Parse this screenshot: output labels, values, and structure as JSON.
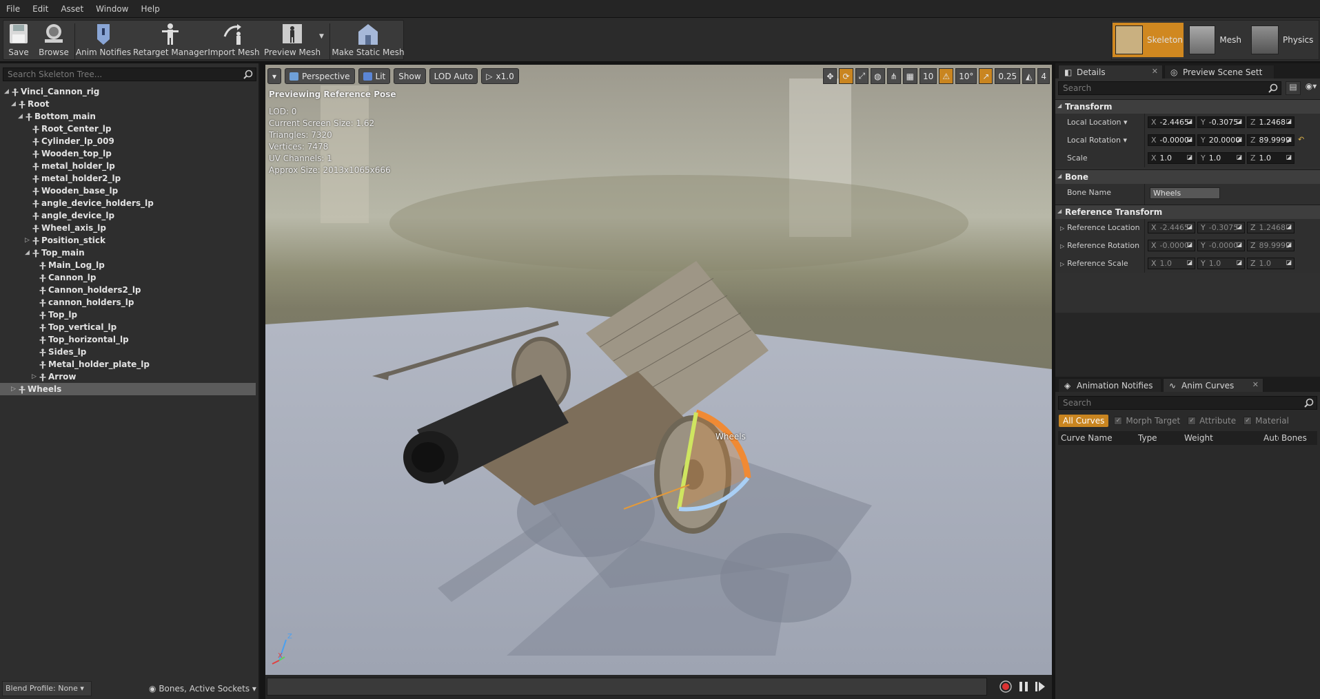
{
  "menu": [
    "File",
    "Edit",
    "Asset",
    "Window",
    "Help"
  ],
  "toolbar": {
    "save": "Save",
    "browse": "Browse",
    "anim_notifies": "Anim Notifies",
    "retarget_manager": "Retarget Manager",
    "import_mesh": "Import Mesh",
    "preview_mesh": "Preview Mesh",
    "make_static_mesh": "Make Static Mesh"
  },
  "modes": {
    "skeleton": "Skeleton",
    "mesh": "Mesh",
    "physics": "Physics"
  },
  "skeleton_tree": {
    "search_placeholder": "Search Skeleton Tree...",
    "nodes": [
      "Vinci_Cannon_rig",
      "Root",
      "Bottom_main",
      "Root_Center_lp",
      "Cylinder_lp_009",
      "Wooden_top_lp",
      "metal_holder_lp",
      "metal_holder2_lp",
      "Wooden_base_lp",
      "angle_device_holders_lp",
      "angle_device_lp",
      "Wheel_axis_lp",
      "Position_stick",
      "Top_main",
      "Main_Log_lp",
      "Cannon_lp",
      "Cannon_holders2_lp",
      "cannon_holders_lp",
      "Top_lp",
      "Top_vertical_lp",
      "Top_horizontal_lp",
      "Sides_lp",
      "Metal_holder_plate_lp",
      "Arrow",
      "Wheels"
    ],
    "blend_profile": "Blend Profile: None",
    "bones_filter": "Bones, Active Sockets"
  },
  "viewport": {
    "perspective": "Perspective",
    "lit": "Lit",
    "show": "Show",
    "lod": "LOD Auto",
    "speed": "x1.0",
    "grid_snap": "10",
    "rot_snap": "10°",
    "scale_snap": "0.25",
    "cam_speed": "4",
    "header": "Previewing Reference Pose",
    "info": {
      "lod": "LOD: 0",
      "screen_size": "Current Screen Size: 1.62",
      "triangles": "Triangles: 7320",
      "vertices": "Vertices: 7478",
      "uv_channels": "UV Channels: 1",
      "approx_size": "Approx Size: 2013x1065x666"
    },
    "bone_label": "Wheels",
    "axis_z": "Z",
    "axis_x": "X"
  },
  "details": {
    "tab_details": "Details",
    "tab_preview": "Preview Scene Sett",
    "search_placeholder": "Search",
    "transform": {
      "title": "Transform",
      "local_location": {
        "label": "Local Location",
        "x": "-2.4465",
        "y": "-0.3075",
        "z": "1.2468"
      },
      "local_rotation": {
        "label": "Local Rotation",
        "x": "-0.0000",
        "y": "20.0000",
        "z": "89.9999"
      },
      "scale": {
        "label": "Scale",
        "x": "1.0",
        "y": "1.0",
        "z": "1.0"
      }
    },
    "bone": {
      "title": "Bone",
      "name_label": "Bone Name",
      "name_value": "Wheels"
    },
    "reference": {
      "title": "Reference Transform",
      "location": {
        "label": "Reference Location",
        "x": "-2.4465",
        "y": "-0.3075",
        "z": "1.2468"
      },
      "rotation": {
        "label": "Reference Rotation",
        "x": "-0.0000",
        "y": "-0.0000",
        "z": "89.9999"
      },
      "scale": {
        "label": "Reference Scale",
        "x": "1.0",
        "y": "1.0",
        "z": "1.0"
      }
    }
  },
  "anim": {
    "tab_notifies": "Animation Notifies",
    "tab_curves": "Anim Curves",
    "search_placeholder": "Search",
    "all_curves": "All Curves",
    "morph_target": "Morph Target",
    "attribute": "Attribute",
    "material": "Material",
    "columns": {
      "curve_name": "Curve Name",
      "type": "Type",
      "weight": "Weight",
      "auto": "Auto",
      "bones": "Bones"
    }
  },
  "colors": {
    "accent": "#d08820",
    "panel": "#2e2e2e",
    "selected": "#5c5c5c"
  }
}
